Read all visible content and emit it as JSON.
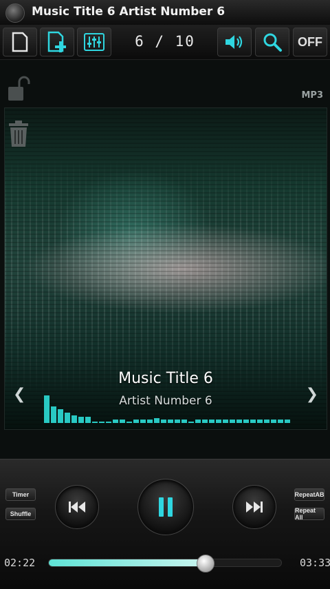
{
  "titlebar": {
    "title": "Music Title 6 Artist Number 6"
  },
  "toolbar": {
    "track_counter": "6 / 10",
    "off_label": "OFF",
    "accent_color": "#2fd6e0"
  },
  "side": {
    "format_label": "MP3"
  },
  "now_playing": {
    "title": "Music Title 6",
    "artist": "Artist Number 6"
  },
  "visualizer": {
    "levels": [
      0.9,
      0.55,
      0.45,
      0.35,
      0.25,
      0.2,
      0.2,
      0.05,
      0.05,
      0.05,
      0.12,
      0.12,
      0.05,
      0.12,
      0.12,
      0.12,
      0.15,
      0.12,
      0.12,
      0.12,
      0.12,
      0.05,
      0.12,
      0.12,
      0.12,
      0.12,
      0.12,
      0.12,
      0.12,
      0.12,
      0.12,
      0.12,
      0.12,
      0.12,
      0.12,
      0.12
    ]
  },
  "controls": {
    "timer_label": "Timer",
    "shuffle_label": "Shuffle",
    "repeat_ab_label": "RepeatAB",
    "repeat_all_label": "Repeat All"
  },
  "progress": {
    "elapsed": "02:22",
    "total": "03:33",
    "fraction": 0.667
  }
}
